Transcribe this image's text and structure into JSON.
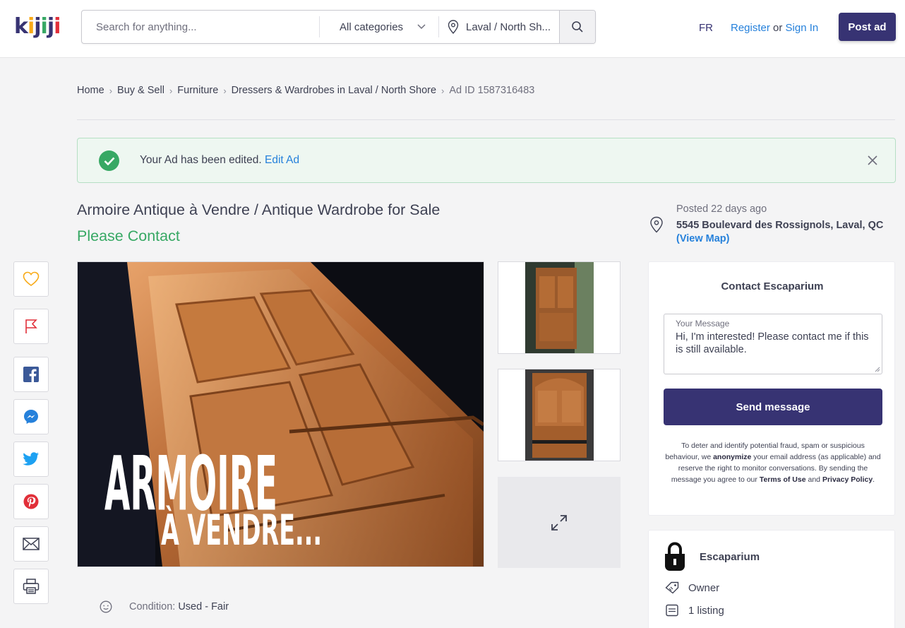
{
  "header": {
    "logo_text": "kijiji",
    "search_placeholder": "Search for anything...",
    "category_label": "All categories",
    "location_label": "Laval / North Sh...",
    "lang_label": "FR",
    "register_label": "Register",
    "or_label": "or",
    "signin_label": "Sign In",
    "post_ad_label": "Post ad"
  },
  "breadcrumb": {
    "items": [
      "Home",
      "Buy & Sell",
      "Furniture",
      "Dressers & Wardrobes in Laval / North Shore"
    ],
    "ad_id": "Ad ID 1587316483"
  },
  "banner": {
    "message": "Your Ad has been edited.",
    "link": "Edit Ad"
  },
  "listing": {
    "title": "Armoire Antique à Vendre / Antique Wardrobe for Sale",
    "price": "Please Contact",
    "image_overlay_line1": "ARMOIRE",
    "image_overlay_line2": "À VENDRE...",
    "condition_label": "Condition:",
    "condition_value": "Used - Fair"
  },
  "location": {
    "posted": "Posted 22 days ago",
    "address": "5545 Boulevard des Rossignols, Laval, QC",
    "view_map": "(View Map)"
  },
  "contact": {
    "title": "Contact Escaparium",
    "message_label": "Your Message",
    "message_value": "Hi, I'm interested! Please contact me if this is still available.",
    "send_label": "Send message",
    "disclaimer_1": "To deter and identify potential fraud, spam or suspicious behaviour, we",
    "disclaimer_bold1": "anonymize",
    "disclaimer_2": "your email address (as applicable) and reserve the right to monitor conversations. By sending the message you agree to our",
    "disclaimer_terms": "Terms of Use",
    "disclaimer_and": "and",
    "disclaimer_privacy": "Privacy Policy",
    "disclaimer_end": "."
  },
  "seller": {
    "name": "Escaparium",
    "type": "Owner",
    "listings": "1 listing"
  },
  "colors": {
    "brand": "#373373",
    "link": "#2681db",
    "success": "#37a864",
    "alert_red": "#e12f39"
  },
  "icons": {
    "rail": [
      "heart-icon",
      "flag-icon",
      "facebook-icon",
      "messenger-icon",
      "twitter-icon",
      "pinterest-icon",
      "email-icon",
      "print-icon"
    ]
  }
}
